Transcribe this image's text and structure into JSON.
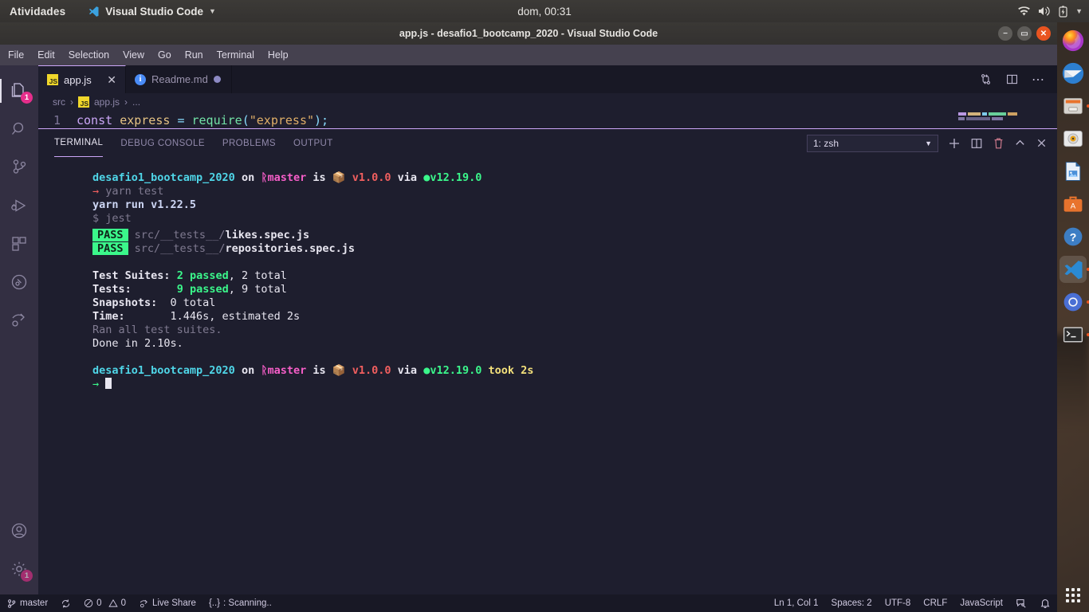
{
  "topbar": {
    "activities": "Atividades",
    "app_name": "Visual Studio Code",
    "app_icon": "vscode-icon",
    "clock": "dom, 00:31",
    "tray_icons": [
      "wifi-icon",
      "volume-icon",
      "battery-icon",
      "chevron-down-icon"
    ]
  },
  "window": {
    "title": "app.js - desafio1_bootcamp_2020 - Visual Studio Code",
    "controls": [
      "minimize-button",
      "maximize-button",
      "close-button"
    ]
  },
  "menubar": {
    "items": [
      "File",
      "Edit",
      "Selection",
      "View",
      "Go",
      "Run",
      "Terminal",
      "Help"
    ]
  },
  "activitybar": {
    "items": [
      {
        "name": "explorer",
        "icon": "files-icon",
        "badge": "1",
        "active": true
      },
      {
        "name": "search",
        "icon": "search-icon",
        "badge": "",
        "active": false
      },
      {
        "name": "source-control",
        "icon": "source-control-icon",
        "badge": "",
        "active": false
      },
      {
        "name": "run-debug",
        "icon": "run-debug-icon",
        "badge": "",
        "active": false
      },
      {
        "name": "extensions",
        "icon": "extensions-icon",
        "badge": "",
        "active": false
      },
      {
        "name": "gitlens",
        "icon": "gitlens-icon",
        "badge": "",
        "active": false
      },
      {
        "name": "live-share",
        "icon": "live-share-icon",
        "badge": "",
        "active": false
      }
    ],
    "bottom": [
      {
        "name": "accounts",
        "icon": "account-icon",
        "badge": ""
      },
      {
        "name": "settings",
        "icon": "gear-icon",
        "badge": "1"
      }
    ]
  },
  "editor": {
    "tabs": [
      {
        "label": "app.js",
        "icon": "js-file-icon",
        "active": true,
        "dirty": false,
        "close": "✕"
      },
      {
        "label": "Readme.md",
        "icon": "md-info-icon",
        "active": false,
        "dirty": true,
        "close": ""
      }
    ],
    "actions": [
      "split-compare-icon",
      "split-editor-icon",
      "more-actions-icon"
    ],
    "breadcrumb": [
      "src",
      "app.js",
      "..."
    ],
    "breadcrumb_separator": "›",
    "line_number": "1",
    "code_tokens": [
      {
        "text": "const ",
        "cls": "k-const"
      },
      {
        "text": "express ",
        "cls": "k-var"
      },
      {
        "text": "= ",
        "cls": "k-op"
      },
      {
        "text": "require",
        "cls": "k-fn"
      },
      {
        "text": "(",
        "cls": "k-punc"
      },
      {
        "text": "\"express\"",
        "cls": "k-str"
      },
      {
        "text": ");",
        "cls": "k-punc"
      }
    ]
  },
  "panel": {
    "tabs": [
      {
        "label": "TERMINAL",
        "active": true
      },
      {
        "label": "DEBUG CONSOLE",
        "active": false
      },
      {
        "label": "PROBLEMS",
        "active": false
      },
      {
        "label": "OUTPUT",
        "active": false
      }
    ],
    "terminal_select": "1: zsh",
    "terminal_select_chevron": "⌄",
    "actions": [
      "new-terminal-icon",
      "split-terminal-icon",
      "kill-terminal-icon",
      "maximize-panel-icon",
      "close-panel-icon"
    ]
  },
  "terminal": {
    "prompt1": {
      "dir": "desafio1_bootcamp_2020",
      "on": "on",
      "branch_icon": "ᚱ",
      "branch": "master",
      "is": "is",
      "pkg_icon": "📦",
      "version": "v1.0.0",
      "via": "via",
      "node_icon": "●",
      "node_version": "v12.19.0",
      "took": ""
    },
    "command": "yarn test",
    "arrow": "→",
    "lines": [
      "yarn run v1.22.5",
      "$ jest"
    ],
    "yarn_run": "yarn run v1.22.5",
    "jest_cmd": "$ jest",
    "pass_rows": [
      {
        "badge": "PASS",
        "path": "src/__tests__/",
        "file": "likes.spec.js"
      },
      {
        "badge": "PASS",
        "path": "src/__tests__/",
        "file": "repositories.spec.js"
      }
    ],
    "summary": [
      {
        "label": "Test Suites:",
        "pad": " ",
        "pass": "2 passed",
        "rest": ", 2 total"
      },
      {
        "label": "Tests:",
        "pad": "       ",
        "pass": "9 passed",
        "rest": ", 9 total"
      }
    ],
    "snapshots_label": "Snapshots:",
    "snapshots_value": "  0 total",
    "time_label": "Time:",
    "time_value": "       1.446s, estimated 2s",
    "ran_all": "Ran all test suites.",
    "done": "Done in 2.10s.",
    "prompt2": {
      "dir": "desafio1_bootcamp_2020",
      "on": "on",
      "branch_icon": "ᚱ",
      "branch": "master",
      "is": "is",
      "pkg_icon": "📦",
      "version": "v1.0.0",
      "via": "via",
      "node_icon": "●",
      "node_version": "v12.19.0",
      "took": "took 2s"
    }
  },
  "statusbar": {
    "left": [
      {
        "name": "branch",
        "icon": "source-control-icon",
        "label": "master"
      },
      {
        "name": "sync",
        "icon": "sync-icon",
        "label": ""
      },
      {
        "name": "problems",
        "icon": "error-warning-icon",
        "label": "0  0"
      },
      {
        "name": "live-share",
        "icon": "live-share-icon",
        "label": "Live Share"
      },
      {
        "name": "scanning",
        "icon": "braces-icon",
        "label": ": Scanning.."
      }
    ],
    "errors": "0",
    "warnings": "0",
    "braces": "{..}",
    "right": [
      {
        "name": "cursor-position",
        "label": "Ln 1, Col 1"
      },
      {
        "name": "indentation",
        "label": "Spaces: 2"
      },
      {
        "name": "encoding",
        "label": "UTF-8"
      },
      {
        "name": "eol",
        "label": "CRLF"
      },
      {
        "name": "language-mode",
        "label": "JavaScript"
      },
      {
        "name": "feedback",
        "label": ""
      },
      {
        "name": "notifications",
        "label": ""
      }
    ]
  },
  "dock": {
    "items": [
      {
        "name": "firefox",
        "running": false,
        "active": false
      },
      {
        "name": "thunderbird",
        "running": false,
        "active": false
      },
      {
        "name": "files",
        "running": true,
        "active": false
      },
      {
        "name": "rhythmbox",
        "running": false,
        "active": false
      },
      {
        "name": "libreoffice-writer",
        "running": false,
        "active": false
      },
      {
        "name": "ubuntu-software",
        "running": false,
        "active": false
      },
      {
        "name": "help",
        "running": false,
        "active": false
      },
      {
        "name": "visual-studio-code",
        "running": true,
        "active": true
      },
      {
        "name": "chromium",
        "running": true,
        "active": false
      },
      {
        "name": "terminal",
        "running": true,
        "active": false
      }
    ],
    "show_applications": "show-applications-icon"
  },
  "colors": {
    "accent": "#cba6f7",
    "ubuntu_orange": "#e95420",
    "badge_pink": "#e62e8b",
    "terminal_green": "#3bf78b",
    "terminal_cyan": "#4fd6e8"
  }
}
